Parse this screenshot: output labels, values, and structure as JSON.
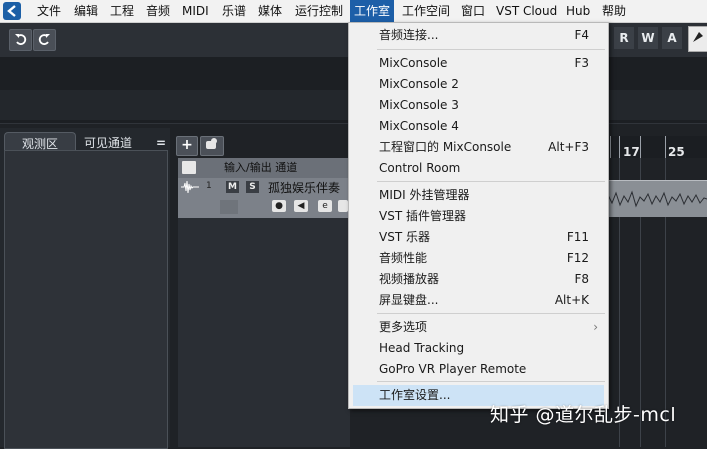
{
  "menubar": {
    "items": [
      "文件",
      "编辑",
      "工程",
      "音频",
      "MIDI",
      "乐谱",
      "媒体",
      "运行控制",
      "工作室",
      "工作空间",
      "窗口",
      "VST Cloud",
      "Hub",
      "帮助"
    ],
    "active_index": 8
  },
  "toolbar": {
    "undo_icon": "undo-icon",
    "redo_icon": "redo-icon",
    "rwa": [
      "R",
      "W",
      "A"
    ]
  },
  "left_zone": {
    "tabs": [
      "观测区",
      "可见通道"
    ],
    "menu_glyph": "="
  },
  "project": {
    "io_channel_label": "输入/输出 通道",
    "track": {
      "number": "1",
      "mute": "M",
      "solo": "S",
      "name": "孤独娱乐伴奏",
      "edit": "e"
    },
    "ruler_bars": [
      "17",
      "25"
    ]
  },
  "dropdown": {
    "items": [
      {
        "label": "音频连接...",
        "shortcut": "F4"
      },
      {
        "label": "MixConsole",
        "shortcut": "F3"
      },
      {
        "label": "MixConsole 2",
        "shortcut": ""
      },
      {
        "label": "MixConsole 3",
        "shortcut": ""
      },
      {
        "label": "MixConsole 4",
        "shortcut": ""
      },
      {
        "label": "工程窗口的 MixConsole",
        "shortcut": "Alt+F3"
      },
      {
        "label": "Control Room",
        "shortcut": ""
      },
      {
        "label": "MIDI 外挂管理器",
        "shortcut": ""
      },
      {
        "label": "VST 插件管理器",
        "shortcut": ""
      },
      {
        "label": "VST 乐器",
        "shortcut": "F11"
      },
      {
        "label": "音频性能",
        "shortcut": "F12"
      },
      {
        "label": "视频播放器",
        "shortcut": "F8"
      },
      {
        "label": "屏显键盘...",
        "shortcut": "Alt+K"
      },
      {
        "label": "更多选项",
        "shortcut": ""
      },
      {
        "label": "Head Tracking",
        "shortcut": ""
      },
      {
        "label": "GoPro VR Player Remote",
        "shortcut": ""
      },
      {
        "label": "工作室设置...",
        "shortcut": ""
      }
    ],
    "submenu_glyph": "›",
    "highlight_index": 16
  },
  "watermark": "知乎 @道尔乱步-mcl",
  "colors": {
    "menu_active": "#1d5fa8",
    "menu_highlight": "#cde3f6",
    "background": "#1f2226"
  }
}
